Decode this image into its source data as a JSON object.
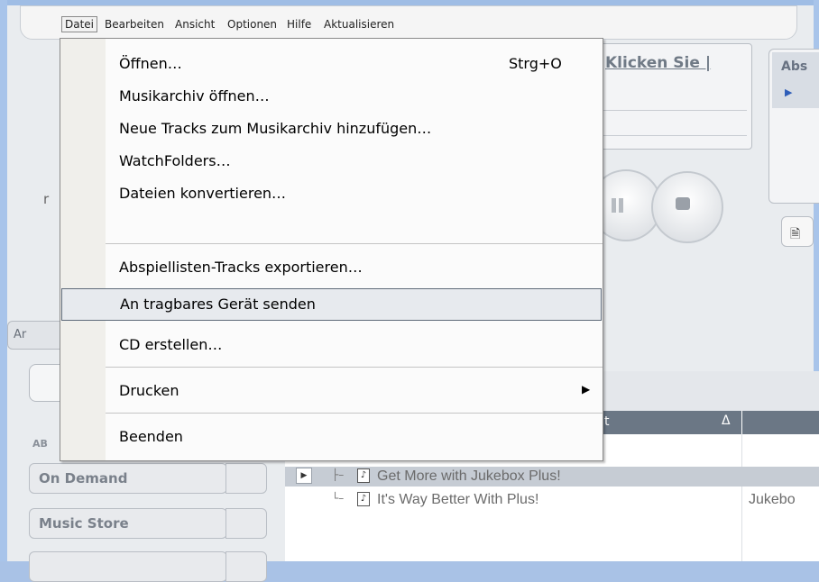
{
  "menubar": {
    "items": [
      {
        "label": "Datei"
      },
      {
        "label": "Bearbeiten"
      },
      {
        "label": "Ansicht"
      },
      {
        "label": "Optionen"
      },
      {
        "label": "Hilfe"
      },
      {
        "label": "Aktualisieren"
      }
    ]
  },
  "menu": {
    "open": "Datei",
    "items": [
      {
        "label": "Öffnen…",
        "shortcut": "Strg+O"
      },
      {
        "label": "Musikarchiv öffnen…"
      },
      {
        "label": "Neue Tracks zum Musikarchiv hinzufügen…"
      },
      {
        "label": "WatchFolders…"
      },
      {
        "label": "Dateien konvertieren…"
      },
      {
        "label": "Abspiellisten-Tracks exportieren…"
      },
      {
        "label": "An tragbares Gerät senden",
        "highlighted": true
      },
      {
        "label": "CD erstellen…"
      },
      {
        "label": "Drucken",
        "submenu": true
      },
      {
        "label": "Beenden"
      }
    ]
  },
  "now_playing": {
    "text": "Klicken Sie |"
  },
  "abs_panel": {
    "label": "Abs"
  },
  "left": {
    "tab_partial": "Ar",
    "section_label": "AB",
    "nav": [
      "On Demand",
      "Music Store",
      ""
    ]
  },
  "table": {
    "column_header_partial": "t",
    "sort_glyph": "Δ",
    "tracks": [
      {
        "title": "Get More with Jukebox Plus!",
        "second_col": ""
      },
      {
        "title": "It's Way Better With Plus!",
        "second_col": "Jukebo"
      }
    ]
  },
  "colors": {
    "highlight_border": "#5f6b7a",
    "menu_gutter": "#f0efeb",
    "header_dark": "#6b7785"
  }
}
